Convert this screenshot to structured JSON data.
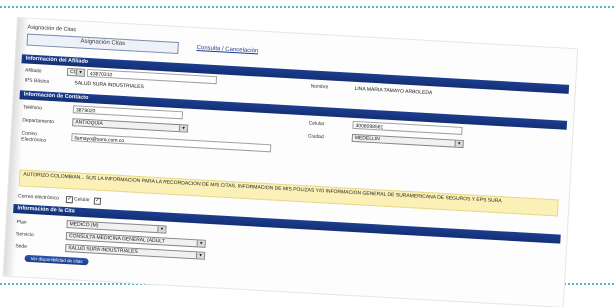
{
  "header": {
    "label": "Asignación de Citas",
    "tab_assign": "Asignación Citas",
    "tab_consult": "Consulta / Cancelación"
  },
  "affiliate": {
    "section_title": "Información del Afiliado",
    "id_label": "Afiliado",
    "id_type": "CC",
    "id_number": "43870310",
    "name_label": "Nombre",
    "name_value": "LINA MARIA TAMAYO ARBOLEDA",
    "eps_label": "IPS Básica",
    "eps_value": "SALUD SURA INDUSTRIALES"
  },
  "contact": {
    "section_title": "Información de Contacto",
    "phone_label": "Teléfono",
    "phone_value": "3879020",
    "cell_label": "Celular",
    "cell_value": "3008098581",
    "department_label": "Departamento",
    "department_value": "ANTIOQUIA",
    "city_label": "Ciudad",
    "city_value": "MEDELLIN",
    "email_label": "Correo Electrónico",
    "email_value": "ltamayo@sura.com.co"
  },
  "notice": {
    "text": "AUTORIZO COLOMBIAN... SUS LA INFORMACION PARA LA RECORDACION DE MIS CITAS, INFORMACION DE MIS POLIZAS Y/O INFORMACION GENERAL DE SURAMERICANA DE SEGUROS Y EPS SURA"
  },
  "consent": {
    "label": "Correo electrónico",
    "option": "Celular"
  },
  "appointment": {
    "section_title": "Información de la Cita",
    "plan_label": "Plan",
    "plan_value": "MEDICO (M)",
    "service_label": "Servicio",
    "service_value": "CONSULTA MEDICINA GENERAL (ADULT",
    "site_label": "Sede",
    "site_value": "SALUD SURA INDUSTRIALES",
    "submit_label": "Ver disponibilidad de citas"
  },
  "colors": {
    "bar": "#1c3e8f",
    "notice_bg": "#fbf0b6",
    "border_dots": "#4fb8c9"
  }
}
